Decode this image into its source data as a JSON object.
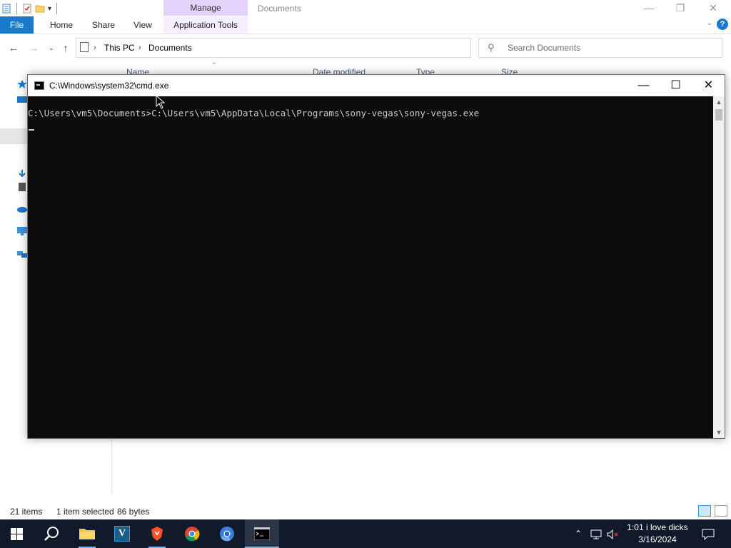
{
  "explorer": {
    "title": "Documents",
    "context_tab_group": "Manage",
    "ribbon_tabs": [
      "File",
      "Home",
      "Share",
      "View",
      "Application Tools"
    ],
    "help_glyph": "?",
    "window_controls": [
      "minimize",
      "maximize",
      "close"
    ],
    "breadcrumb": [
      "This PC",
      "Documents"
    ],
    "search_placeholder": "Search Documents",
    "columns": [
      "Name",
      "Date modified",
      "Type",
      "Size"
    ],
    "status": {
      "item_count": "21 items",
      "selection": "1 item selected",
      "selection_size": "86 bytes"
    },
    "view_buttons": [
      "details-view",
      "large-icons-view"
    ]
  },
  "cmd": {
    "title": "C:\\Windows\\system32\\cmd.exe",
    "line": "C:\\Users\\vm5\\Documents>C:\\Users\\vm5\\AppData\\Local\\Programs\\sony-vegas\\sony-vegas.exe",
    "background_color": "#0c0c0c",
    "text_color": "#cccccc"
  },
  "taskbar": {
    "apps": [
      {
        "name": "start",
        "icon": "windows-logo-icon"
      },
      {
        "name": "search",
        "icon": "search-icon"
      },
      {
        "name": "file-explorer",
        "icon": "folder-icon",
        "running": true
      },
      {
        "name": "visual-studio",
        "icon": "v-app-icon",
        "glyph": "V"
      },
      {
        "name": "brave",
        "icon": "brave-lion-icon",
        "running": true
      },
      {
        "name": "chrome",
        "icon": "chrome-icon"
      },
      {
        "name": "chromium",
        "icon": "chromium-icon"
      },
      {
        "name": "cmd",
        "icon": "terminal-icon",
        "active": true
      }
    ],
    "clock_time": "1:01 i love dicks",
    "clock_date": "3/16/2024"
  },
  "colors": {
    "file_tab": "#1979ca",
    "manage_tab": "#e5d2fb",
    "taskbar": "#101a2a",
    "taskbar_indicator": "#7fb2e5"
  }
}
